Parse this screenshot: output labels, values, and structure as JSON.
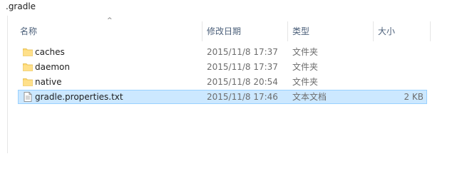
{
  "window": {
    "title": ".gradle"
  },
  "columns": {
    "name": "名称",
    "date": "修改日期",
    "type": "类型",
    "size": "大小",
    "sort_indicator": "^"
  },
  "files": [
    {
      "name": "caches",
      "date": "2015/11/8 17:37",
      "type": "文件夹",
      "size": "",
      "icon": "folder-icon",
      "selected": false
    },
    {
      "name": "daemon",
      "date": "2015/11/8 17:37",
      "type": "文件夹",
      "size": "",
      "icon": "folder-icon",
      "selected": false
    },
    {
      "name": "native",
      "date": "2015/11/8 20:54",
      "type": "文件夹",
      "size": "",
      "icon": "folder-icon",
      "selected": false
    },
    {
      "name": "gradle.properties.txt",
      "date": "2015/11/8 17:46",
      "type": "文本文档",
      "size": "2 KB",
      "icon": "text-document-icon",
      "selected": true
    }
  ],
  "colors": {
    "selection_bg": "#cce8ff",
    "selection_border": "#99d1ff",
    "folder_yellow": "#ffd86b",
    "header_text": "#4c607a"
  }
}
